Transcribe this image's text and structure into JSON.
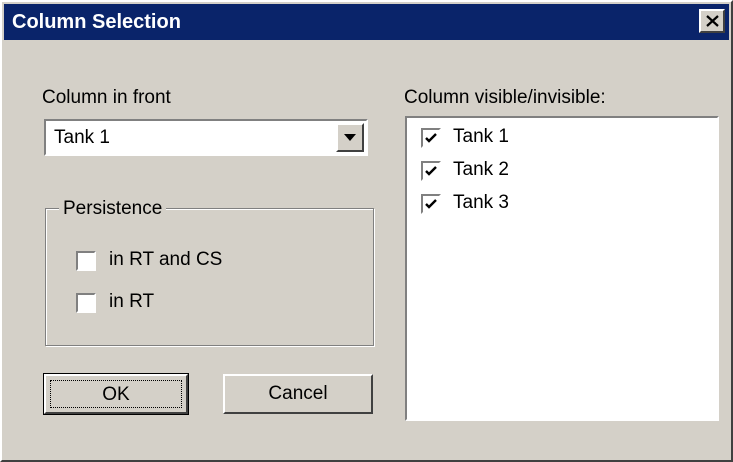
{
  "window": {
    "title": "Column Selection"
  },
  "front": {
    "label": "Column in front",
    "selected": "Tank 1"
  },
  "persistence": {
    "legend": "Persistence",
    "options": [
      {
        "label": "in RT and CS",
        "checked": false
      },
      {
        "label": "in RT",
        "checked": false
      }
    ]
  },
  "buttons": {
    "ok": "OK",
    "cancel": "Cancel"
  },
  "visibility": {
    "label": "Column visible/invisible:",
    "items": [
      {
        "label": "Tank 1",
        "checked": true
      },
      {
        "label": "Tank 2",
        "checked": true
      },
      {
        "label": "Tank 3",
        "checked": true
      }
    ]
  }
}
